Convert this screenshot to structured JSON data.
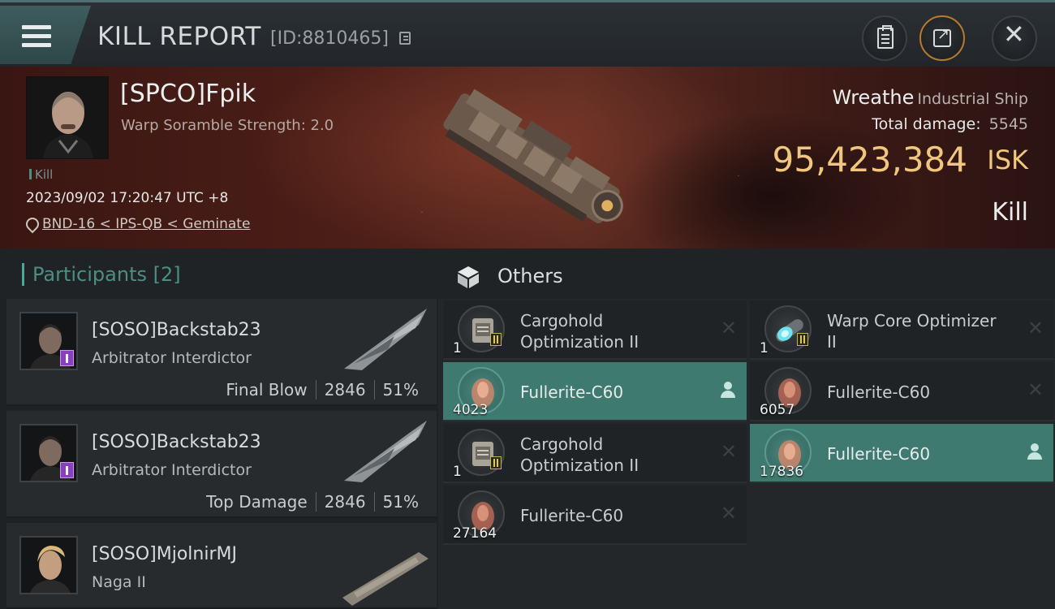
{
  "header": {
    "title": "KILL REPORT",
    "report_id": "[ID:8810465]"
  },
  "victim": {
    "name": "[SPCO]Fpik",
    "subtitle": "Warp Soramble Strength: 2.0",
    "tag": "Kill",
    "datetime": "2023/09/02 17:20:47 UTC +8",
    "location": "BND-16 < IPS-QB < Geminate"
  },
  "ship": {
    "name": "Wreathe",
    "class": "Industrial Ship",
    "total_damage_label": "Total damage:",
    "total_damage": "5545",
    "isk_value": "95,423,384",
    "isk_unit": "ISK",
    "result": "Kill"
  },
  "participants": {
    "label": "Participants [2]",
    "rows": [
      {
        "name": "[SOSO]Backstab23",
        "ship": "Arbitrator Interdictor",
        "role": "Final Blow",
        "damage": "2846",
        "percent": "51%"
      },
      {
        "name": "[SOSO]Backstab23",
        "ship": "Arbitrator Interdictor",
        "role": "Top Damage",
        "damage": "2846",
        "percent": "51%"
      },
      {
        "name": "[SOSO]MjolnirMJ",
        "ship": "Naga II"
      }
    ]
  },
  "others": {
    "label": "Others",
    "items": [
      {
        "qty": "1",
        "name_line1": "Cargohold",
        "name_line2": "Optimization II",
        "status": "destroyed"
      },
      {
        "qty": "1",
        "name_line1": "Warp Core Optimizer",
        "name_line2": "II",
        "status": "destroyed"
      },
      {
        "qty": "4023",
        "name_line1": "Fullerite-C60",
        "status": "dropped"
      },
      {
        "qty": "6057",
        "name_line1": "Fullerite-C60",
        "status": "destroyed"
      },
      {
        "qty": "1",
        "name_line1": "Cargohold",
        "name_line2": "Optimization II",
        "status": "destroyed"
      },
      {
        "qty": "17836",
        "name_line1": "Fullerite-C60",
        "status": "dropped"
      },
      {
        "qty": "27164",
        "name_line1": "Fullerite-C60",
        "status": "destroyed"
      }
    ]
  },
  "colors": {
    "accent": "#4fa596",
    "isk_gold": "#f0c77c",
    "highlight_row": "#3f7a70",
    "banner_red": "#4d1f18"
  },
  "icons": [
    "menu-icon",
    "copy-icon",
    "clipboard-icon",
    "share-icon",
    "close-icon",
    "pin-icon",
    "cube-icon",
    "x-icon",
    "person-icon"
  ]
}
